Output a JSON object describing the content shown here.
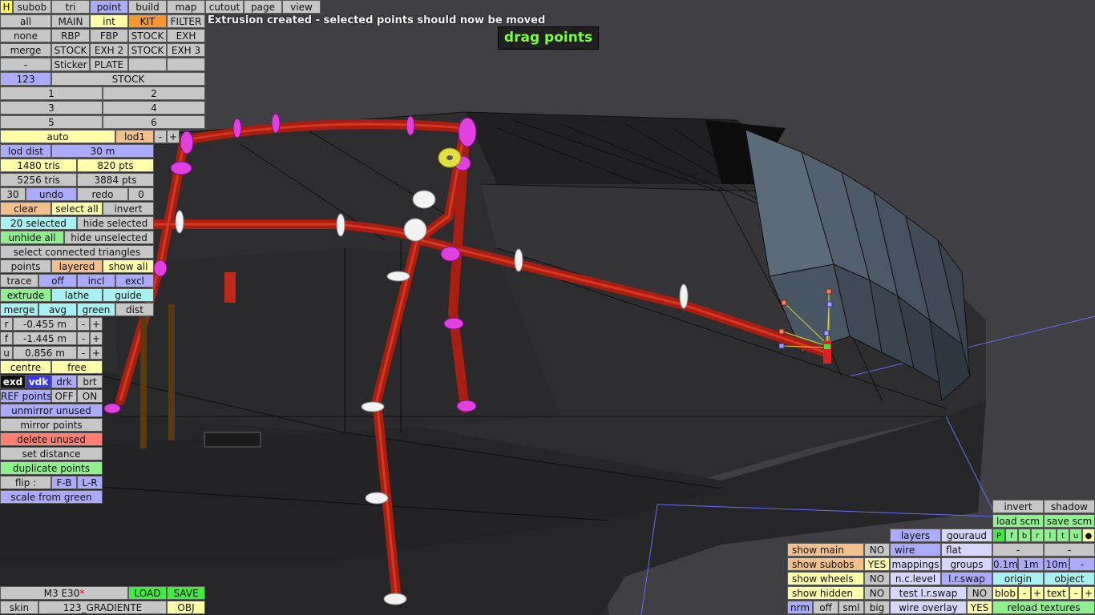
{
  "status_message": "Extrusion created - selected points should now be moved",
  "mode_label": "drag points",
  "top_menu": {
    "h": "H",
    "subob": "subob",
    "tri": "tri",
    "point": "point",
    "build": "build",
    "map": "map",
    "cutout": "cutout",
    "page": "page",
    "view": "view"
  },
  "left": {
    "r1": [
      "all",
      "MAIN",
      "int",
      "KIT",
      "FILTER"
    ],
    "r2": [
      "none",
      "RBP",
      "FBP",
      "STOCK",
      "EXH"
    ],
    "r3": [
      "merge",
      "STOCK",
      "EXH 2",
      "STOCK",
      "EXH 3"
    ],
    "r4": [
      "-",
      "Sticker",
      "PLATE",
      "",
      ""
    ],
    "lod_num": "123",
    "lod_name": "STOCK",
    "nums": [
      "1",
      "2",
      "3",
      "4",
      "5",
      "6"
    ],
    "auto": "auto",
    "lod1": "lod1",
    "minus": "-",
    "plus": "+",
    "lod_dist": "lod dist",
    "lod_dist_val": "30 m",
    "tris1": "1480 tris",
    "pts1": "820 pts",
    "tris2": "5256 tris",
    "pts2": "3884 pts",
    "undo_n": "30",
    "undo": "undo",
    "redo": "redo",
    "redo_n": "0",
    "clear": "clear",
    "select_all": "select all",
    "invert": "invert",
    "selected": "20 selected",
    "hide_selected": "hide selected",
    "unhide_all": "unhide all",
    "hide_unselected": "hide unselected",
    "select_connected": "select connected triangles",
    "points": "points",
    "layered": "layered",
    "show_all": "show all",
    "trace": "trace",
    "off": "off",
    "incl": "incl",
    "excl": "excl",
    "extrude": "extrude",
    "lathe": "lathe",
    "guide": "guide",
    "merge2": "merge",
    "avg": "avg",
    "green": "green",
    "dist": "dist",
    "r_label": "r",
    "r_val": "-0.455 m",
    "f_label": "f",
    "f_val": "-1.445 m",
    "u_label": "u",
    "u_val": "0.856 m",
    "centre": "centre",
    "free": "free",
    "exd": "exd",
    "vdk": "vdk",
    "drk": "drk",
    "brt": "brt",
    "ref_points": "REF points",
    "ref_off": "OFF",
    "ref_on": "ON",
    "unmirror_unused": "unmirror unused",
    "mirror_points": "mirror points",
    "delete_unused": "delete unused",
    "set_distance": "set distance",
    "duplicate_points": "duplicate points",
    "flip": "flip :",
    "fb": "F-B",
    "lr": "L-R",
    "scale_from_green": "scale from green"
  },
  "bottom_left": {
    "car": "M3 E30",
    "car_mod": "*",
    "load": "LOAD",
    "save": "SAVE",
    "skin": "skin",
    "skin_name": "123_GRADIENTE",
    "obj": "OBJ"
  },
  "bottom_right": {
    "show_main": "show main",
    "show_main_v": "NO",
    "show_subobs": "show subobs",
    "show_subobs_v": "YES",
    "show_wheels": "show wheels",
    "show_wheels_v": "NO",
    "show_hidden": "show hidden",
    "show_hidden_v": "NO",
    "nrm": "nrm",
    "off": "off",
    "sml": "sml",
    "big": "big",
    "layers": "layers",
    "gouraud": "gouraud",
    "wire": "wire",
    "flat": "flat",
    "mappings": "mappings",
    "groups": "groups",
    "nclevel": "n.c.level",
    "lrswap": "l.r.swap",
    "test_lrswap": "test l.r.swap",
    "test_lrswap_v": "NO",
    "wire_overlay": "wire overlay",
    "wire_overlay_v": "YES",
    "invert": "invert",
    "shadow": "shadow",
    "load_scm": "load scm",
    "save_scm": "save scm",
    "flags": [
      "P",
      "f",
      "b",
      "r",
      "l",
      "t",
      "u",
      "●"
    ],
    "dash1": "-",
    "dash2": "-",
    "m01": "0.1m",
    "m1": "1m",
    "m10": "10m",
    "mdash": "-",
    "origin": "origin",
    "object": "object",
    "blob": "blob",
    "text": "text",
    "pm": [
      "-",
      "+",
      "-",
      "+"
    ],
    "reload_textures": "reload textures"
  }
}
